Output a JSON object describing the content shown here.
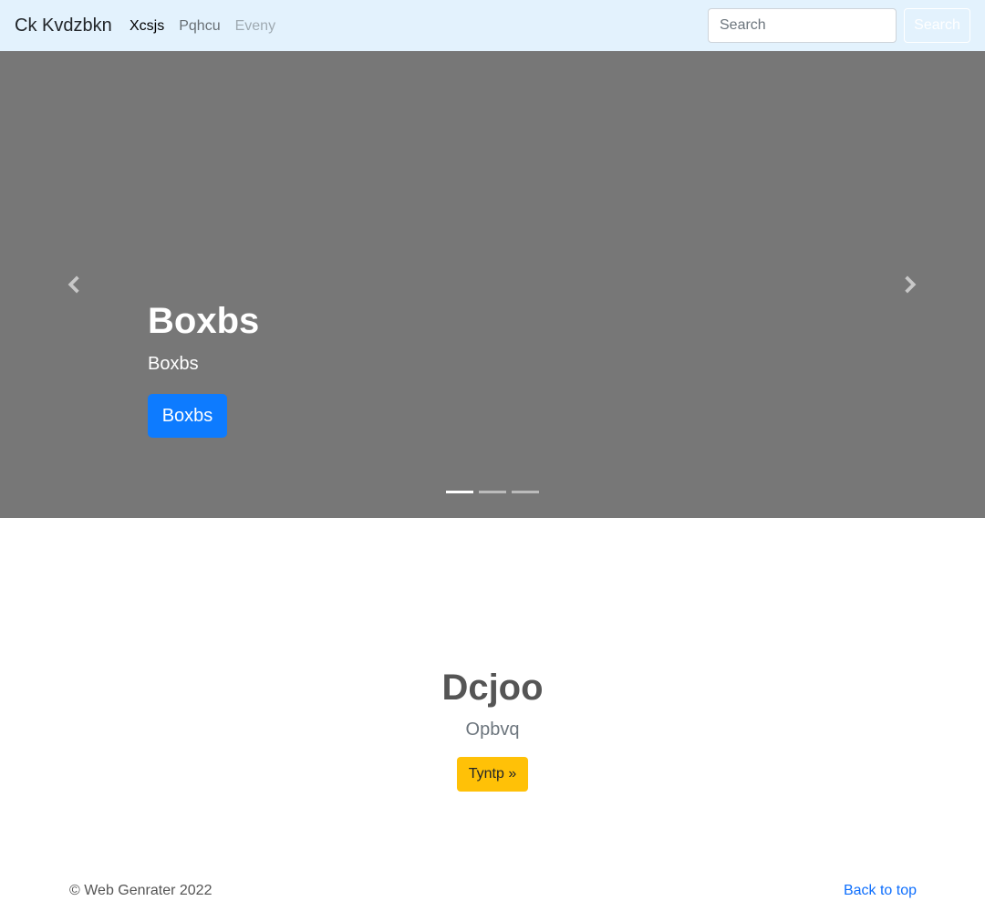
{
  "navbar": {
    "brand": "Ck Kvdzbkn",
    "links": [
      {
        "label": "Xcsjs",
        "state": "active"
      },
      {
        "label": "Pqhcu",
        "state": "normal"
      },
      {
        "label": "Eveny",
        "state": "disabled"
      }
    ],
    "search_placeholder": "Search",
    "search_button": "Search"
  },
  "carousel": {
    "title": "Boxbs",
    "subtitle": "Boxbs",
    "button": "Boxbs",
    "prev_icon": "chevron-left-icon",
    "next_icon": "chevron-right-icon",
    "slide_count": 3,
    "active_index": 0,
    "background_color": "#777777"
  },
  "hero": {
    "title": "Dcjoo",
    "subtitle": "Opbvq",
    "button": "Tyntp »",
    "button_color": "#ffc107"
  },
  "footer": {
    "copyright": "© Web Genrater 2022",
    "back_to_top": "Back to top"
  },
  "colors": {
    "navbar_bg": "#e3f2fd",
    "primary": "#0d7bff",
    "link": "#0d6efd"
  }
}
